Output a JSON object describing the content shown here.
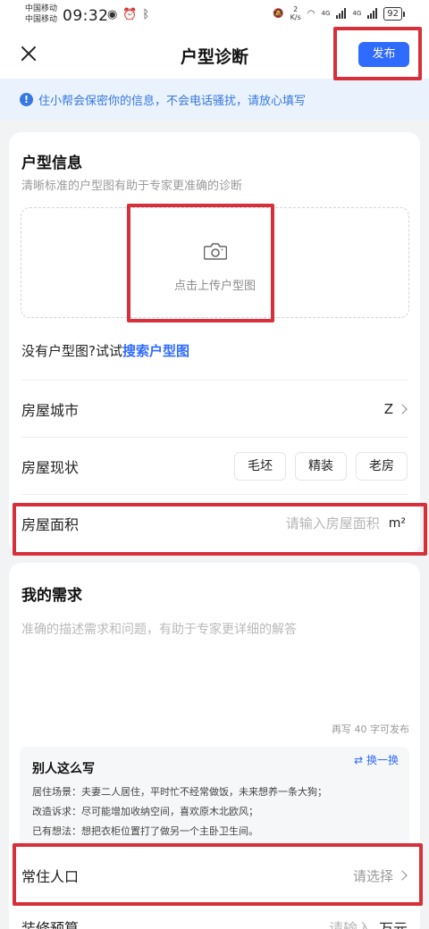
{
  "status_bar": {
    "carrier_1": "中国移动",
    "carrier_2": "中国移动",
    "time": "09:32",
    "speed_value": "2",
    "speed_unit": "K/s",
    "net_1": "4G",
    "net_2": "4G",
    "battery": "92"
  },
  "header": {
    "title": "户型诊断",
    "publish_label": "发布"
  },
  "notice": {
    "text": "住小帮会保密你的信息，不会电话骚扰，请放心填写"
  },
  "floor_plan": {
    "title": "户型信息",
    "subtitle": "清晰标准的户型图有助于专家更准确的诊断",
    "upload_label": "点击上传户型图",
    "no_plan_prefix": "没有户型图?试试",
    "search_link": "搜索户型图"
  },
  "house_city": {
    "label": "房屋城市",
    "value": "Z"
  },
  "house_status": {
    "label": "房屋现状",
    "options": [
      "毛坯",
      "精装",
      "老房"
    ]
  },
  "house_area": {
    "label": "房屋面积",
    "placeholder": "请输入房屋面积",
    "unit": "m²"
  },
  "needs": {
    "title": "我的需求",
    "placeholder": "准确的描述需求和问题，有助于专家更详细的解答",
    "char_count": "再写 40 字可发布"
  },
  "example": {
    "title": "别人这么写",
    "swap_label": "换一换",
    "lines": [
      "居住场景：夫妻二人居住，平时忙不经常做饭，未来想养一条大狗；",
      "改造诉求：尽可能增加收纳空间，喜欢原木北欧风；",
      "已有想法：想把衣柜位置打了做另一个主卧卫生间。"
    ]
  },
  "residents": {
    "label": "常住人口",
    "value": "请选择"
  },
  "budget": {
    "label": "装修预算",
    "value": "请输入",
    "unit": "万元"
  },
  "colors": {
    "accent": "#2f6bff",
    "notice_bg": "#eaf2fd",
    "highlight": "#d7303b"
  }
}
